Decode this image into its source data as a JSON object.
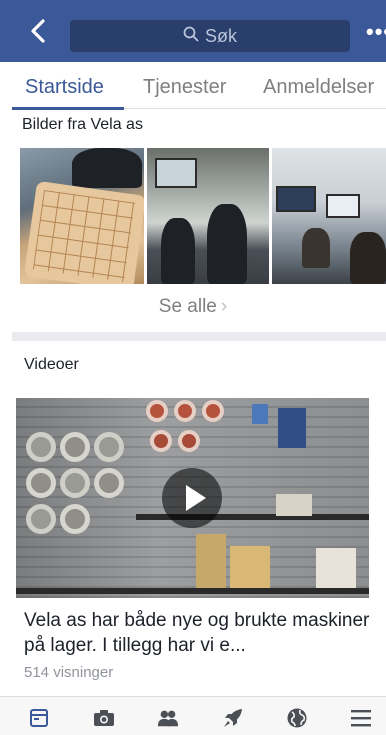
{
  "header": {
    "search_label": "Søk",
    "more_label": "•••",
    "icons": {
      "back": "back-chevron-icon",
      "search": "search-icon",
      "more": "more-dots-icon"
    }
  },
  "tabs": [
    {
      "label": "Startside",
      "active": true
    },
    {
      "label": "Tjenester",
      "active": false
    },
    {
      "label": "Anmeldelser",
      "active": false
    }
  ],
  "photos": {
    "title": "Bilder fra Vela as",
    "see_all": "Se alle",
    "see_all_chevron": "›"
  },
  "videos": {
    "title": "Videoer",
    "caption": "Vela as har både nye og brukte maskiner på lager. I tillegg har vi e...",
    "views": "514 visninger"
  },
  "bottom_nav": [
    {
      "name": "home",
      "icon": "page-home-icon",
      "active": true
    },
    {
      "name": "photos",
      "icon": "camera-icon",
      "active": false
    },
    {
      "name": "people",
      "icon": "people-icon",
      "active": false
    },
    {
      "name": "boost",
      "icon": "rocket-icon",
      "active": false
    },
    {
      "name": "globe",
      "icon": "globe-icon",
      "active": false
    },
    {
      "name": "menu",
      "icon": "hamburger-menu-icon",
      "active": false
    }
  ],
  "colors": {
    "brand": "#3b5998",
    "search_bg": "#293e6a",
    "inactive_text": "#7f7f7f",
    "divider": "#e9ebee"
  }
}
